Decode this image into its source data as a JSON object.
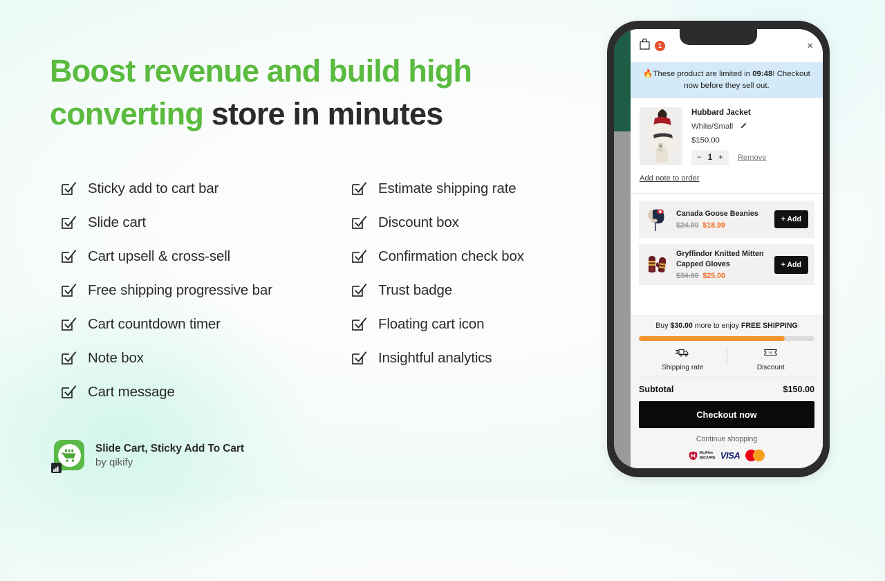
{
  "marketing": {
    "headline_green_1": "Boost revenue and build high",
    "headline_green_2": "converting",
    "headline_dark_2": " store in minutes",
    "accent_green": "#5bbb3f",
    "features_left": [
      "Sticky add to cart bar",
      "Slide cart",
      "Cart upsell & cross-sell",
      "Free shipping progressive bar",
      "Cart countdown timer",
      "Note box",
      "Cart message"
    ],
    "features_right": [
      "Estimate shipping rate",
      "Discount box",
      "Confirmation check box",
      "Trust badge",
      "Floating cart icon",
      "Insightful analytics"
    ],
    "brand": {
      "app_name": "Slide Cart, Sticky Add To Cart",
      "developer": "by qikify",
      "logo_icon": "shopping-cart-icon",
      "logo_color": "#5bb947"
    }
  },
  "phone": {
    "cart": {
      "header": {
        "bag_icon": "shopping-bag-icon",
        "item_count": "1",
        "badge_color": "#e8502a",
        "close_icon": "close-icon",
        "close_label": "×"
      },
      "countdown_banner": {
        "flame_icon": "🔥",
        "text_before": "These product are limited in ",
        "timer": "09:48",
        "text_after": "! Checkout now before they sell out.",
        "background": "#d4eaf8"
      },
      "line_item": {
        "title": "Hubbard Jacket",
        "variant": "White/Small",
        "edit_icon": "pencil-icon",
        "price": "$150.00",
        "minus": "−",
        "quantity": "1",
        "plus": "+",
        "remove_label": "Remove"
      },
      "note_link": "Add note to order",
      "upsells": [
        {
          "name": "Canada Goose Beanies",
          "old_price": "$24.00",
          "new_price": "$18.99",
          "add_label": "+ Add",
          "thumb_icon": "trapper-hat-icon"
        },
        {
          "name": "Gryffindor Knitted Mitten Capped Gloves",
          "old_price": "$34.00",
          "new_price": "$25.00",
          "add_label": "+ Add",
          "thumb_icon": "mittens-icon"
        }
      ],
      "free_shipping": {
        "msg_prefix": "Buy ",
        "amount": "$30.00",
        "msg_middle": " more to enjoy ",
        "msg_bold": "FREE SHIPPING",
        "progress_percent": "83",
        "bar_color": "#f5952f"
      },
      "actions": [
        {
          "label": "Shipping rate",
          "icon": "delivery-truck-icon"
        },
        {
          "label": "Discount",
          "icon": "discount-ticket-icon"
        }
      ],
      "summary": {
        "subtotal_label": "Subtotal",
        "subtotal_value": "$150.00",
        "checkout_label": "Checkout now",
        "continue_label": "Continue shopping"
      },
      "trust_badges": {
        "mcafee_line1": "McAfee",
        "mcafee_line2": "SECURE",
        "visa": "VISA",
        "mastercard": "mastercard"
      }
    }
  }
}
